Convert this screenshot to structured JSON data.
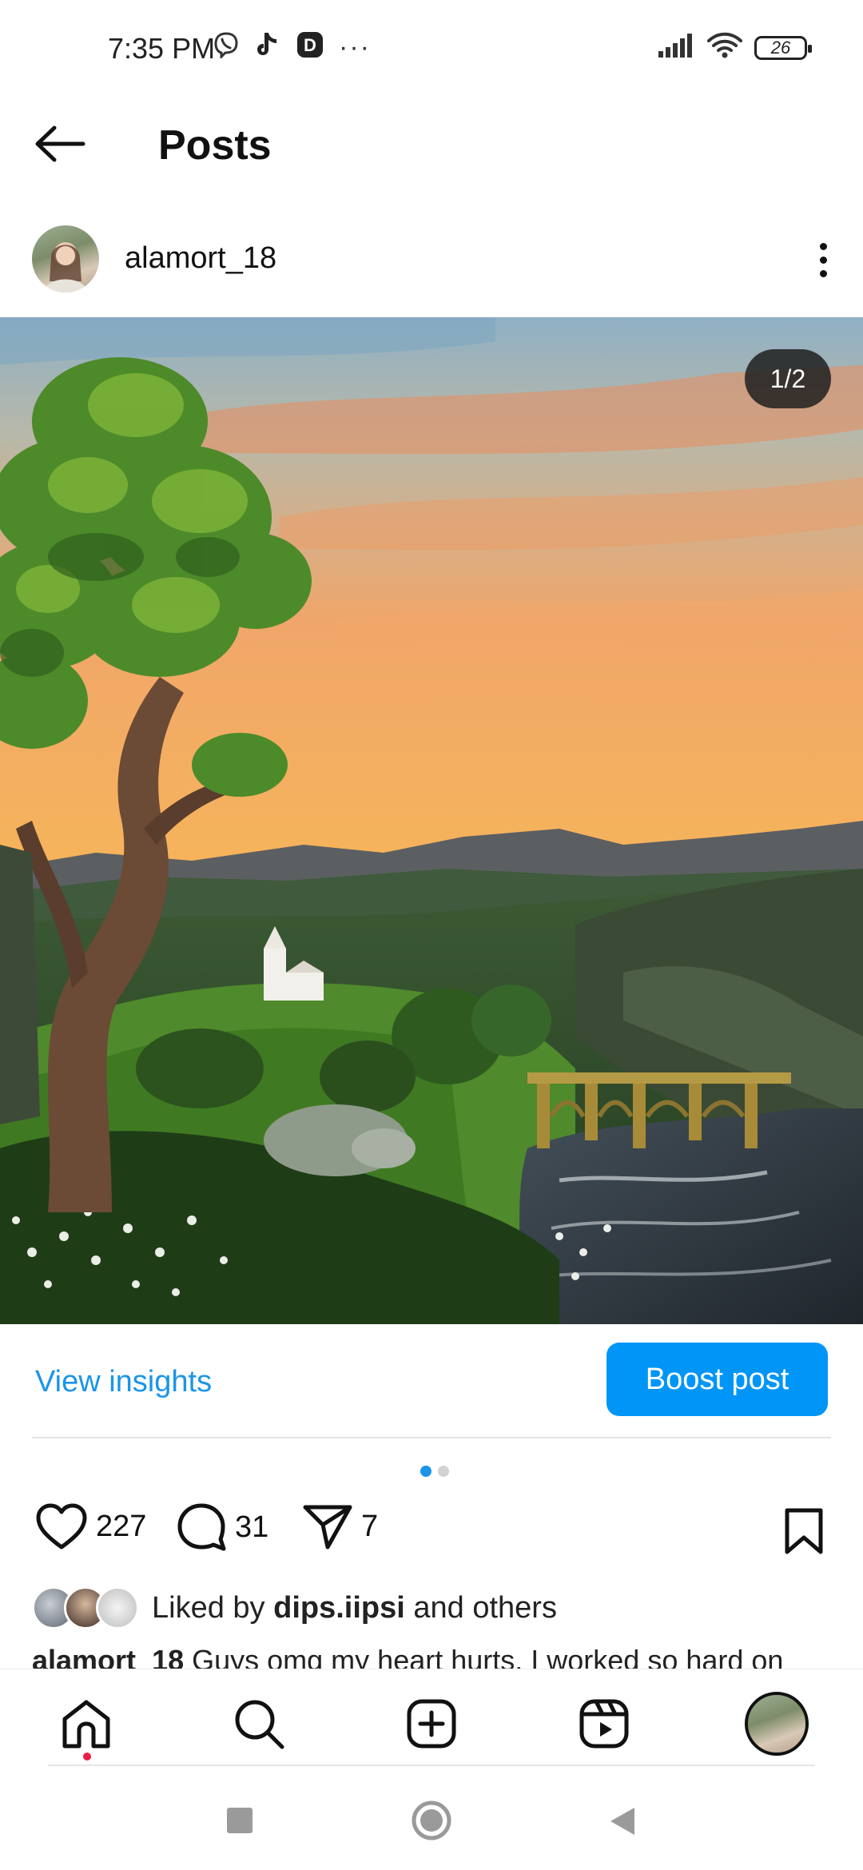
{
  "status_bar": {
    "time": "7:35 PM",
    "left_icons": [
      "viber-icon",
      "tiktok-icon",
      "app-d-icon",
      "more-dots-icon"
    ],
    "right_icons": [
      "signal-icon",
      "wifi-icon"
    ],
    "battery": "26"
  },
  "header": {
    "title": "Posts",
    "back_icon": "back-arrow-icon"
  },
  "post": {
    "username": "alamort_18",
    "counter": "1/2",
    "image_description_icon": "landscape-painting"
  },
  "actions": {
    "view_insights": "View insights",
    "boost_post": "Boost post"
  },
  "carousel": {
    "total": 2,
    "active": 1
  },
  "engagement": {
    "likes": "227",
    "comments": "31",
    "shares": "7"
  },
  "liked_by": {
    "prefix": "Liked by",
    "user": "dips.iipsi",
    "suffix": "and others"
  },
  "caption": {
    "user": "alamort_18",
    "text": "Guys omg my heart hurts. I worked so hard on"
  },
  "bottom_nav": {
    "items": [
      "home-icon",
      "search-icon",
      "create-icon",
      "reels-icon",
      "profile-avatar"
    ]
  },
  "colors": {
    "accent": "#0095f6",
    "link": "#1b95e8",
    "notification": "#ed1b49"
  }
}
